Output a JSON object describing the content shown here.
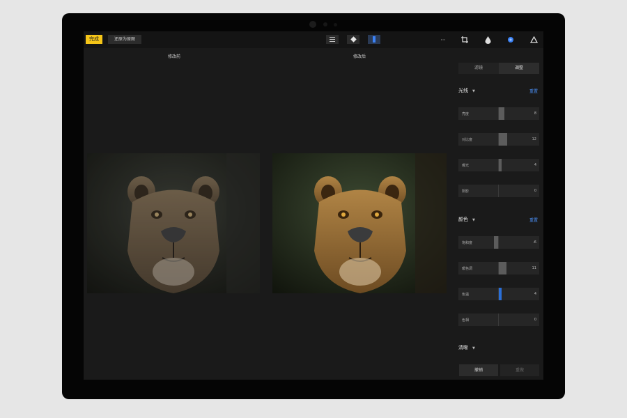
{
  "toolbar": {
    "done_label": "完成",
    "revert_label": "还原为原图",
    "more_label": "···"
  },
  "compare": {
    "before_label": "修改前",
    "after_label": "修改后"
  },
  "panel": {
    "tabs": [
      {
        "label": "滤镜",
        "selected": false
      },
      {
        "label": "调整",
        "selected": true
      }
    ],
    "light": {
      "title": "光线",
      "reset_label": "重置",
      "sliders": [
        {
          "label": "亮度",
          "value": "8",
          "level": 8
        },
        {
          "label": "对比度",
          "value": "12",
          "level": 12
        },
        {
          "label": "曝光",
          "value": "4",
          "level": 4
        },
        {
          "label": "阴影",
          "value": "0",
          "level": 0
        }
      ]
    },
    "color": {
      "title": "颜色",
      "reset_label": "重置",
      "sliders": [
        {
          "label": "饱和度",
          "value": "-6",
          "level": -6
        },
        {
          "label": "暖色调",
          "value": "11",
          "level": 11
        },
        {
          "label": "色温",
          "value": "4",
          "level": 4,
          "active": true
        },
        {
          "label": "色相",
          "value": "0",
          "level": 0
        }
      ]
    },
    "clarity": {
      "title": "清晰"
    },
    "bottom": {
      "undo_label": "撤销",
      "redo_label": "重做"
    }
  },
  "colors": {
    "accent": "#f5c518",
    "link_blue": "#4a8ef2",
    "active_slider": "#2a6fd8",
    "background": "#1a1a1a"
  }
}
